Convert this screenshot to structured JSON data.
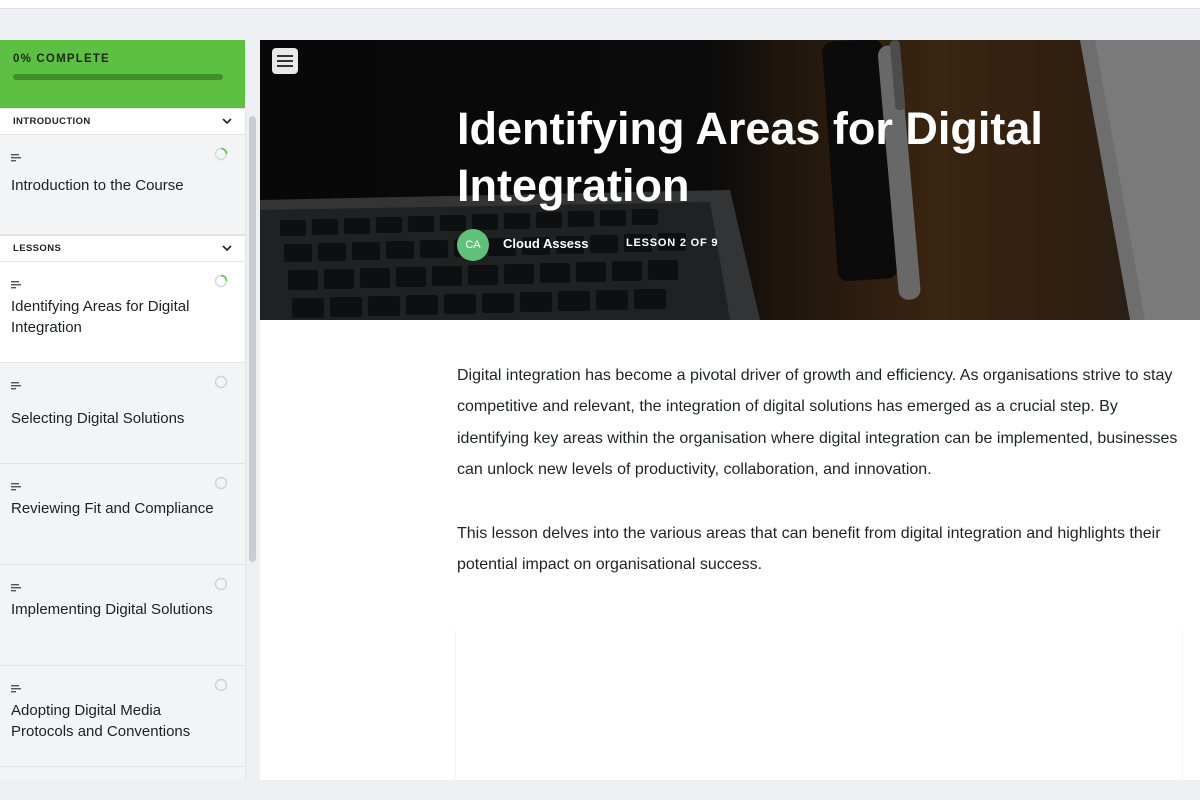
{
  "sidebar": {
    "progress": {
      "label": "0% COMPLETE",
      "percent": 0
    },
    "sections": [
      {
        "title": "INTRODUCTION",
        "items": [
          {
            "title": "Introduction to the Course",
            "status": "in-progress"
          }
        ]
      },
      {
        "title": "LESSONS",
        "items": [
          {
            "title": "Identifying Areas for Digital Integration",
            "status": "in-progress",
            "active": true
          },
          {
            "title": "Selecting Digital Solutions",
            "status": "not-started"
          },
          {
            "title": "Reviewing Fit and Compliance",
            "status": "not-started"
          },
          {
            "title": "Implementing Digital Solutions",
            "status": "not-started"
          },
          {
            "title": "Adopting Digital Media Protocols and Conventions",
            "status": "not-started"
          }
        ]
      }
    ]
  },
  "hero": {
    "title": "Identifying Areas for Digital Integration",
    "author_initials": "CA",
    "author_name": "Cloud Assess",
    "lesson_counter": "LESSON 2 OF 9"
  },
  "content": {
    "paragraphs": [
      "Digital integration has become a pivotal driver of growth and efficiency. As organisations strive to stay competitive and relevant, the integration of digital solutions has emerged as a crucial step. By identifying key areas within the organisation where digital integration can be implemented, businesses can unlock new levels of productivity, collaboration, and innovation.",
      "This lesson delves into the various areas that can benefit from digital integration and highlights their potential impact on organisational success."
    ]
  },
  "icons": {
    "menu": "hamburger-menu-icon",
    "chevron": "chevron-down-icon",
    "lesson": "text-lines-icon",
    "status_in_progress": "progress-ring-icon",
    "status_not_started": "empty-circle-icon"
  },
  "colors": {
    "progress_green": "#5cc043",
    "avatar_green": "#61c07a",
    "status_green": "#5cc043"
  }
}
